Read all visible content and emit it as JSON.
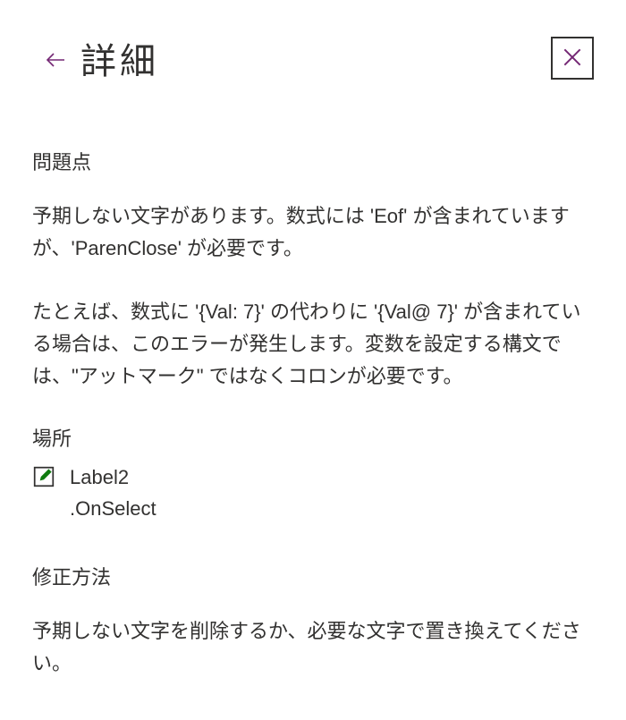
{
  "header": {
    "title": "詳細"
  },
  "issue": {
    "heading": "問題点",
    "paragraph1": "予期しない文字があります。数式には 'Eof' が含まれていますが、'ParenClose' が必要です。",
    "paragraph2": "たとえば、数式に '{Val: 7}' の代わりに '{Val@ 7}' が含まれている場合は、このエラーが発生します。変数を設定する構文では、\"アットマーク\" ではなくコロンが必要です。"
  },
  "location": {
    "heading": "場所",
    "control": "Label2",
    "property": ".OnSelect"
  },
  "fix": {
    "heading": "修正方法",
    "paragraph": "予期しない文字を削除するか、必要な文字で置き換えてください。"
  },
  "colors": {
    "accent": "#742774"
  }
}
